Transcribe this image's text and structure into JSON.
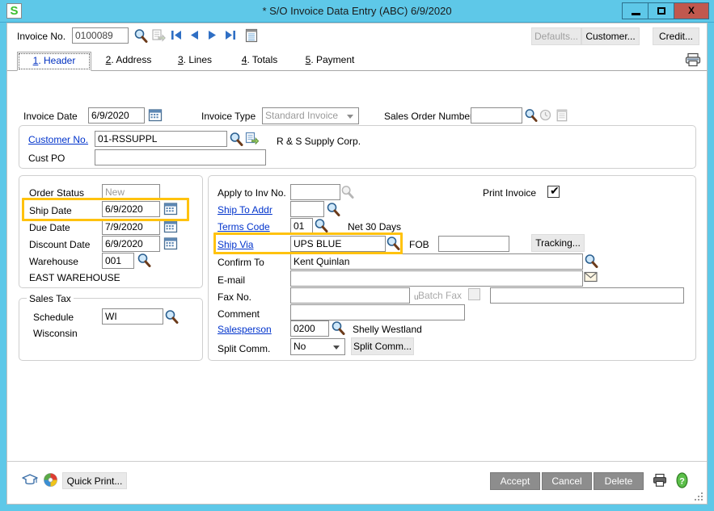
{
  "window": {
    "title": "* S/O Invoice Data Entry (ABC) 6/9/2020",
    "logo_letter": "S",
    "minimize": "minimize-icon",
    "maximize": "maximize-icon",
    "close": "X"
  },
  "toolbar": {
    "invoice_no_label": "Invoice No.",
    "invoice_no_value": "0100089",
    "lookup_icon": "magnifier-icon",
    "new_record_icon": "new-record-icon",
    "first_icon": "first-record-icon",
    "prev_icon": "previous-record-icon",
    "next_icon": "next-record-icon",
    "last_icon": "last-record-icon",
    "memo_icon": "memo-icon",
    "defaults_label": "Defaults...",
    "customer_label": "Customer...",
    "credit_label": "Credit...",
    "print_icon": "printer-icon"
  },
  "tabs": [
    {
      "num": "1",
      "label": ". Header",
      "active": true
    },
    {
      "num": "2",
      "label": ". Address",
      "active": false
    },
    {
      "num": "3",
      "label": ". Lines",
      "active": false
    },
    {
      "num": "4",
      "label": ". Totals",
      "active": false
    },
    {
      "num": "5",
      "label": ". Payment",
      "active": false
    }
  ],
  "header_row": {
    "invoice_date_label": "Invoice Date",
    "invoice_date_value": "6/9/2020",
    "calendar_icon": "calendar-icon",
    "invoice_type_label": "Invoice Type",
    "invoice_type_value": "Standard Invoice",
    "sales_order_number_label": "Sales Order Number",
    "sales_order_number_value": "",
    "so_lookup_icon": "magnifier-icon",
    "so_clock_icon": "history-icon",
    "so_memo_icon": "memo-icon"
  },
  "customer_panel": {
    "customer_no_label": "Customer No.",
    "customer_no_value": "01-RSSUPPL",
    "customer_lookup_icon": "magnifier-icon",
    "customer_drill_icon": "drill-down-icon",
    "customer_name": "R & S Supply Corp.",
    "cust_po_label": "Cust PO",
    "cust_po_value": ""
  },
  "order_panel": {
    "order_status_label": "Order Status",
    "order_status_value": "New",
    "ship_date_label": "Ship Date",
    "ship_date_value": "6/9/2020",
    "due_date_label": "Due Date",
    "due_date_value": "7/9/2020",
    "discount_date_label": "Discount Date",
    "discount_date_value": "6/9/2020",
    "warehouse_label": "Warehouse",
    "warehouse_value": "001",
    "warehouse_name": "EAST WAREHOUSE",
    "calendar_icon": "calendar-icon",
    "lookup_icon": "magnifier-icon"
  },
  "sales_tax_panel": {
    "group_title": "Sales Tax",
    "schedule_label": "Schedule",
    "schedule_value": "WI",
    "schedule_name": "Wisconsin",
    "lookup_icon": "magnifier-icon"
  },
  "detail_panel": {
    "apply_to_inv_label": "Apply to Inv No.",
    "apply_to_inv_value": "",
    "ship_to_addr_label": "Ship To Addr",
    "ship_to_addr_value": "",
    "terms_code_label": "Terms Code",
    "terms_code_value": "01",
    "terms_code_desc": "Net 30 Days",
    "ship_via_label": "Ship Via",
    "ship_via_value": "UPS BLUE",
    "fob_label": "FOB",
    "fob_value": "",
    "tracking_label": "Tracking...",
    "confirm_to_label": "Confirm To",
    "confirm_to_value": "Kent Quinlan",
    "email_label": "E-mail",
    "email_value": "",
    "email_icon": "envelope-icon",
    "fax_no_label": "Fax No.",
    "fax_no_value": "",
    "batch_fax_label": "Batch Fax",
    "batch_fax_prefix": "u",
    "batch_fax_extra_value": "",
    "comment_label": "Comment",
    "comment_value": "",
    "salesperson_label": "Salesperson",
    "salesperson_value": "0200",
    "salesperson_name": "Shelly Westland",
    "split_comm_label": "Split Comm.",
    "split_comm_value": "No",
    "split_comm_button": "Split Comm...",
    "print_invoice_label": "Print Invoice",
    "print_invoice_checked": true,
    "lookup_icon": "magnifier-icon"
  },
  "statusbar": {
    "graduation_icon": "graduation-cap-icon",
    "globe_icon": "globe-icon",
    "quick_print_label": "Quick Print...",
    "accept_label": "Accept",
    "cancel_label": "Cancel",
    "delete_label": "Delete",
    "printer_icon": "printer-icon",
    "help_icon": "help-icon"
  },
  "colors": {
    "titlebar": "#5ec8e8",
    "close_button": "#c1584e",
    "highlight": "#ffc20e",
    "link": "#0033cc",
    "button_face": "#e8e8e8"
  }
}
